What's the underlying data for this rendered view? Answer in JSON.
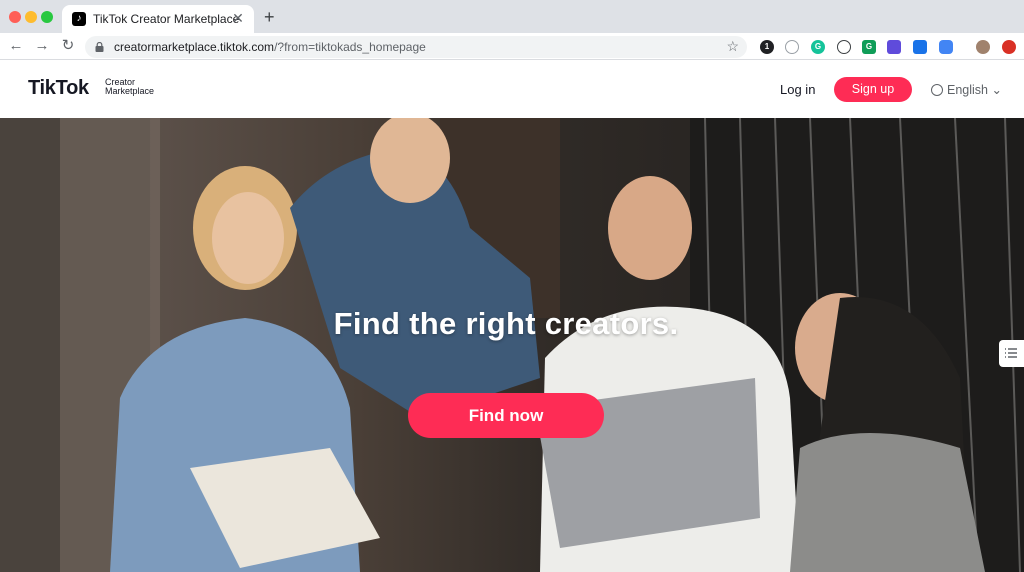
{
  "browser": {
    "tab_title": "TikTok Creator Marketplace",
    "tab_favicon": "♪",
    "url_host": "creatormarketplace.tiktok.com",
    "url_path": "/?from=tiktokads_homepage"
  },
  "header": {
    "logo_main": "TikTok",
    "logo_sub": "Creator\nMarketplace",
    "login_label": "Log in",
    "signup_label": "Sign up",
    "language_label": "English"
  },
  "hero": {
    "title": "Find the right creators.",
    "cta_label": "Find now"
  },
  "colors": {
    "brand": "#fe2c55",
    "text": "#161823"
  }
}
